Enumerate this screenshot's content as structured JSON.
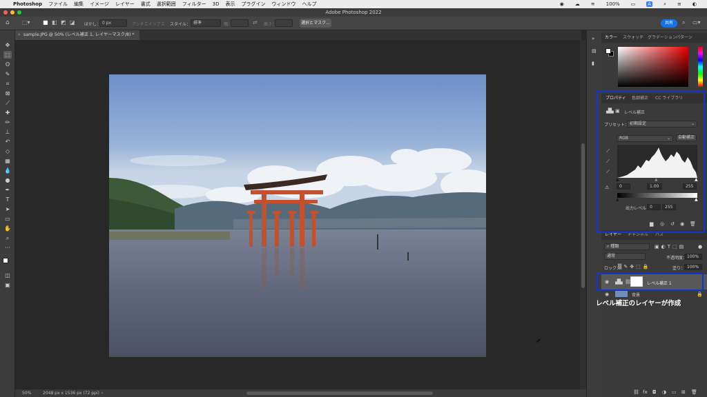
{
  "menubar": {
    "app": "Photoshop",
    "items": [
      "ファイル",
      "編集",
      "イメージ",
      "レイヤー",
      "書式",
      "選択範囲",
      "フィルター",
      "3D",
      "表示",
      "プラグイン",
      "ウィンドウ",
      "ヘルプ"
    ],
    "battery": "100%"
  },
  "window": {
    "title": "Adobe Photoshop 2022"
  },
  "options": {
    "feather_label": "ぼかし：",
    "feather_value": "0 px",
    "antialias": "アンチエイリアス",
    "style_label": "スタイル：",
    "style_value": "標準",
    "width_label": "幅：",
    "height_label": "高さ：",
    "select_mask": "選択とマスク...",
    "share": "共有"
  },
  "document": {
    "tab": "sample.JPG @ 50% (レベル補正 1, レイヤーマスク/8) *"
  },
  "status": {
    "zoom": "50%",
    "size": "2048 px x 1536 px (72 ppi)"
  },
  "color_panel": {
    "tabs": [
      "カラー",
      "スウォッチ",
      "グラデーション",
      "パターン"
    ]
  },
  "properties": {
    "tabs": [
      "プロパティ",
      "色調補正",
      "CC ライブラリ"
    ],
    "title": "レベル補正",
    "preset_label": "プリセット：",
    "preset_value": "初期設定",
    "channel": "RGB",
    "auto": "自動補正",
    "input_black": "0",
    "input_gamma": "1.00",
    "input_white": "255",
    "output_label": "出力レベル：",
    "output_black": "0",
    "output_white": "255"
  },
  "layers_panel": {
    "tabs": [
      "レイヤー",
      "チャンネル",
      "パス"
    ],
    "filter": "種類",
    "blend_mode": "通常",
    "opacity_label": "不透明度：",
    "opacity_value": "100%",
    "lock_label": "ロック：",
    "fill_label": "塗り：",
    "fill_value": "100%",
    "layers": [
      {
        "name": "レベル補正 1"
      },
      {
        "name": "背景"
      }
    ]
  },
  "annotation": {
    "caption": "レベル補正のレイヤーが作成",
    "color": "#1236d6"
  }
}
